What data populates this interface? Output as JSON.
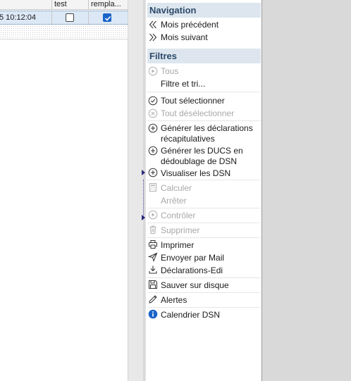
{
  "grid": {
    "headers": [
      {
        "label": ""
      },
      {
        "label": "test"
      },
      {
        "label": "rempla..."
      }
    ],
    "rows": [
      {
        "date": "5 10:12:04",
        "test": false,
        "remplace": true
      }
    ]
  },
  "panel": {
    "navigation": {
      "title": "Navigation",
      "items": [
        {
          "label": "Mois précédent",
          "icon": "double-chevron-left-icon",
          "enabled": true
        },
        {
          "label": "Mois suivant",
          "icon": "double-chevron-right-icon",
          "enabled": true
        }
      ]
    },
    "filtres": {
      "title": "Filtres",
      "items": [
        {
          "label": "Tous",
          "icon": "play-circle-icon",
          "enabled": false
        },
        {
          "label": "Filtre et tri...",
          "icon": "",
          "enabled": true
        },
        {
          "label": "Tout sélectionner",
          "icon": "check-circle-icon",
          "enabled": true
        },
        {
          "label": "Tout désélectionner",
          "icon": "x-circle-icon",
          "enabled": false
        },
        {
          "label": "Générer les déclarations récapitulatives",
          "icon": "plus-circle-icon",
          "enabled": true
        },
        {
          "label": "Générer les DUCS en dédoublage de DSN",
          "icon": "plus-circle-icon",
          "enabled": true
        },
        {
          "label": "Visualiser les DSN",
          "icon": "plus-circle-icon",
          "enabled": true
        },
        {
          "label": "Calculer",
          "icon": "calculator-icon",
          "enabled": false
        },
        {
          "label": "Arrêter",
          "icon": "",
          "enabled": false
        },
        {
          "label": "Contrôler",
          "icon": "play-circle-icon",
          "enabled": false
        },
        {
          "label": "Supprimer",
          "icon": "trash-icon",
          "enabled": false
        },
        {
          "label": "Imprimer",
          "icon": "printer-icon",
          "enabled": true
        },
        {
          "label": "Envoyer par Mail",
          "icon": "send-icon",
          "enabled": true
        },
        {
          "label": "Déclarations-Edi",
          "icon": "download-icon",
          "enabled": true
        },
        {
          "label": "Sauver sur disque",
          "icon": "save-icon",
          "enabled": true
        },
        {
          "label": "Alertes",
          "icon": "pencil-icon",
          "enabled": true
        },
        {
          "label": "Calendrier DSN",
          "icon": "info-icon",
          "enabled": true
        }
      ]
    }
  },
  "colors": {
    "header_bg": "#dde6ee",
    "header_text": "#2c4a6b",
    "checkbox_checked": "#1a64c8",
    "disabled_text": "#a8a8a8",
    "selected_row": "#dce8f5"
  }
}
